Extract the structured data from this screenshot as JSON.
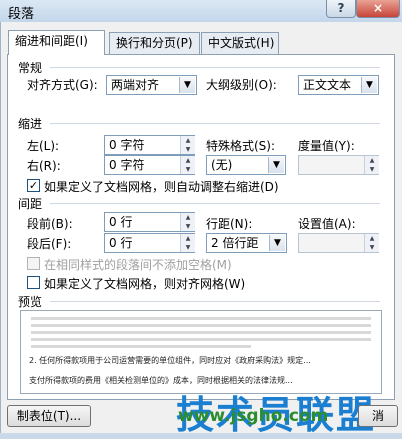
{
  "window": {
    "title": "段落",
    "help": "?",
    "close": "×"
  },
  "tabs": [
    {
      "label": "缩进和间距(I)"
    },
    {
      "label": "换行和分页(P)"
    },
    {
      "label": "中文版式(H)"
    }
  ],
  "general": {
    "heading": "常规",
    "alignment_label": "对齐方式(G):",
    "alignment_value": "两端对齐",
    "outline_label": "大纲级别(O):",
    "outline_value": "正文文本"
  },
  "indent": {
    "heading": "缩进",
    "left_label": "左(L):",
    "left_value": "0 字符",
    "right_label": "右(R):",
    "right_value": "0 字符",
    "special_label": "特殊格式(S):",
    "special_value": "(无)",
    "by_label": "度量值(Y):",
    "by_value": "",
    "auto_adjust_label": "如果定义了文档网格，则自动调整右缩进(D)",
    "auto_adjust_checked": true
  },
  "spacing": {
    "heading": "间距",
    "before_label": "段前(B):",
    "before_value": "0 行",
    "after_label": "段后(F):",
    "after_value": "0 行",
    "line_label": "行距(N):",
    "line_value": "2 倍行距",
    "at_label": "设置值(A):",
    "at_value": "",
    "no_space_label": "在相同样式的段落间不添加空格(M)",
    "no_space_checked": false,
    "snap_grid_label": "如果定义了文档网格，则对齐网格(W)",
    "snap_grid_checked": false
  },
  "preview": {
    "heading": "预览",
    "line1": "2. 任何所得款项用于公司运营需要的单位组件，同时应对《政府采购法》规定...",
    "line2": "支付所得款项的费用《相关检测单位的》成本，同时根据相关的法律法规..."
  },
  "watermark": {
    "text": "技术员联盟",
    "url": "www.jsgho.com"
  },
  "buttons": {
    "tabs": "制表位(T)...",
    "cancel": "消"
  },
  "colors": {
    "accent": "#1a7fd0",
    "watermark_url": "#2c8d2e"
  }
}
